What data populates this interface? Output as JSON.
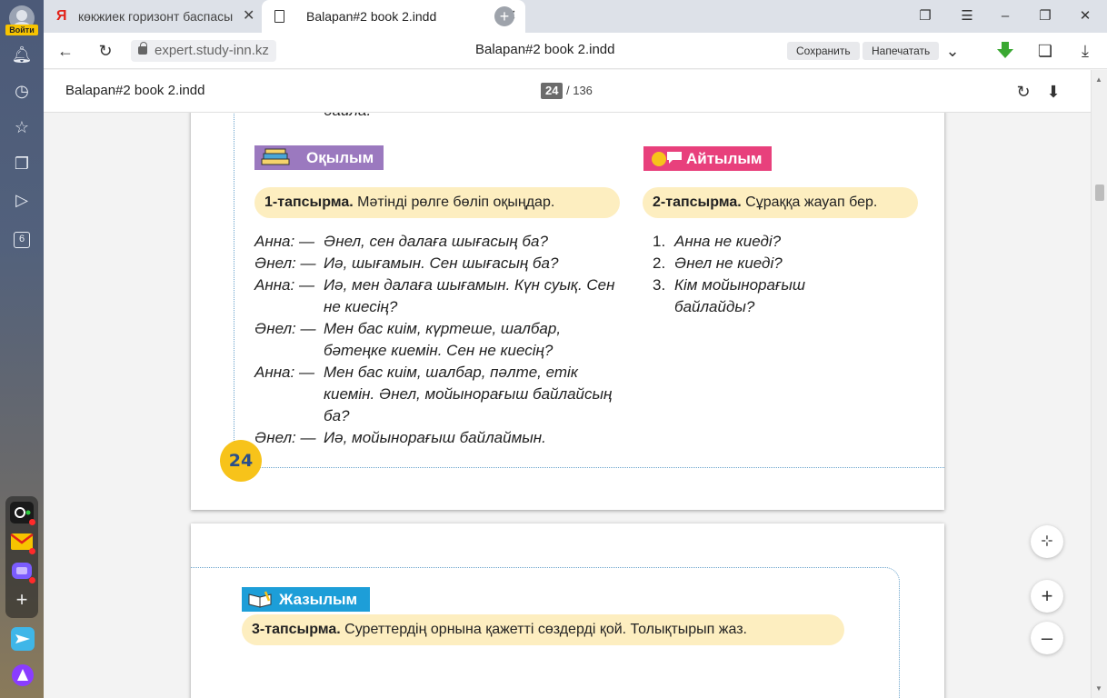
{
  "sidebar": {
    "login_label": "Войти",
    "icons": [
      "bell-icon",
      "history-icon",
      "star-icon",
      "collections-icon",
      "video-icon",
      "counter-icon"
    ],
    "counter_value": "6"
  },
  "tabs": [
    {
      "title": "көкжиек горизонт баспасы",
      "close": "✕"
    },
    {
      "title": "Balapan#2 book 2.indd",
      "close": "✕"
    }
  ],
  "address": {
    "domain": "expert.study-inn.kz",
    "page_title": "Balapan#2 book 2.indd",
    "save_label": "Сохранить",
    "print_label": "Напечатать"
  },
  "pdf": {
    "title": "Balapan#2 book 2.indd",
    "current_page": "24",
    "total_pages": "/ 136"
  },
  "page1": {
    "cut_text": "байла.",
    "section_reading": "Оқылым",
    "section_speaking": "Айтылым",
    "task1_label": "1-тапсырма.",
    "task1_text": "Мәтінді рөлге бөліп оқыңдар.",
    "task2_label": "2-тапсырма.",
    "task2_text": "Сұраққа жауап бер.",
    "dialog": [
      {
        "speaker": "Анна: —",
        "text": "Әнел, сен далаға шығасың ба?"
      },
      {
        "speaker": "Әнел: —",
        "text": "Иә, шығамын. Сен шығасың ба?"
      },
      {
        "speaker": "Анна: —",
        "text": "Иә, мен далаға шығамын. Күн суық. Сен не киесің?"
      },
      {
        "speaker": "Әнел: —",
        "text": "Мен бас киім, күртеше, шалбар, бәтеңке киемін. Сен не киесің?"
      },
      {
        "speaker": "Анна: —",
        "text": "Мен бас киім, шалбар, пәлте, етік киемін. Әнел, мойынорағыш байлайсың ба?"
      },
      {
        "speaker": "Әнел: —",
        "text": "Иә, мойынорағыш байлаймын."
      }
    ],
    "questions": [
      {
        "num": "1.",
        "text": "Анна не киеді?"
      },
      {
        "num": "2.",
        "text": "Әнел не киеді?"
      },
      {
        "num": "3.",
        "text": "Кім мойынорағыш байлайды?"
      }
    ],
    "page_number": "24"
  },
  "page2": {
    "section_writing": "Жазылым",
    "task3_label": "3-тапсырма.",
    "task3_text": "Суреттердің орнына қажетті сөздерді қой. Толықтырып жаз."
  },
  "colors": {
    "reading": "#9b79bf",
    "speaking": "#e8407c",
    "writing": "#1d9ed8",
    "task_bg": "#fdeec0",
    "page_num_bg": "#f7c31a"
  }
}
